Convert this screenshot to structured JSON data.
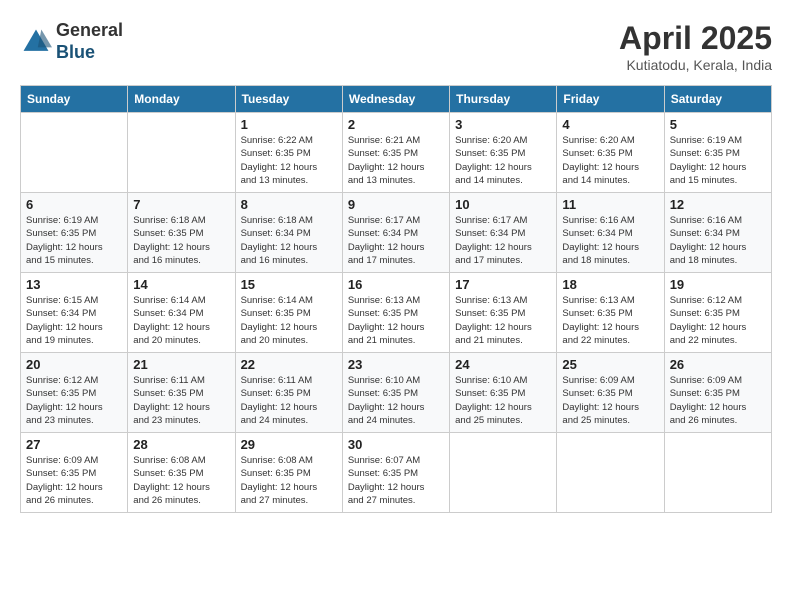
{
  "header": {
    "logo_general": "General",
    "logo_blue": "Blue",
    "month_title": "April 2025",
    "location": "Kutiatodu, Kerala, India"
  },
  "weekdays": [
    "Sunday",
    "Monday",
    "Tuesday",
    "Wednesday",
    "Thursday",
    "Friday",
    "Saturday"
  ],
  "weeks": [
    [
      null,
      null,
      {
        "day": 1,
        "sunrise": "6:22 AM",
        "sunset": "6:35 PM",
        "daylight": "12 hours and 13 minutes."
      },
      {
        "day": 2,
        "sunrise": "6:21 AM",
        "sunset": "6:35 PM",
        "daylight": "12 hours and 13 minutes."
      },
      {
        "day": 3,
        "sunrise": "6:20 AM",
        "sunset": "6:35 PM",
        "daylight": "12 hours and 14 minutes."
      },
      {
        "day": 4,
        "sunrise": "6:20 AM",
        "sunset": "6:35 PM",
        "daylight": "12 hours and 14 minutes."
      },
      {
        "day": 5,
        "sunrise": "6:19 AM",
        "sunset": "6:35 PM",
        "daylight": "12 hours and 15 minutes."
      }
    ],
    [
      {
        "day": 6,
        "sunrise": "6:19 AM",
        "sunset": "6:35 PM",
        "daylight": "12 hours and 15 minutes."
      },
      {
        "day": 7,
        "sunrise": "6:18 AM",
        "sunset": "6:35 PM",
        "daylight": "12 hours and 16 minutes."
      },
      {
        "day": 8,
        "sunrise": "6:18 AM",
        "sunset": "6:34 PM",
        "daylight": "12 hours and 16 minutes."
      },
      {
        "day": 9,
        "sunrise": "6:17 AM",
        "sunset": "6:34 PM",
        "daylight": "12 hours and 17 minutes."
      },
      {
        "day": 10,
        "sunrise": "6:17 AM",
        "sunset": "6:34 PM",
        "daylight": "12 hours and 17 minutes."
      },
      {
        "day": 11,
        "sunrise": "6:16 AM",
        "sunset": "6:34 PM",
        "daylight": "12 hours and 18 minutes."
      },
      {
        "day": 12,
        "sunrise": "6:16 AM",
        "sunset": "6:34 PM",
        "daylight": "12 hours and 18 minutes."
      }
    ],
    [
      {
        "day": 13,
        "sunrise": "6:15 AM",
        "sunset": "6:34 PM",
        "daylight": "12 hours and 19 minutes."
      },
      {
        "day": 14,
        "sunrise": "6:14 AM",
        "sunset": "6:34 PM",
        "daylight": "12 hours and 20 minutes."
      },
      {
        "day": 15,
        "sunrise": "6:14 AM",
        "sunset": "6:35 PM",
        "daylight": "12 hours and 20 minutes."
      },
      {
        "day": 16,
        "sunrise": "6:13 AM",
        "sunset": "6:35 PM",
        "daylight": "12 hours and 21 minutes."
      },
      {
        "day": 17,
        "sunrise": "6:13 AM",
        "sunset": "6:35 PM",
        "daylight": "12 hours and 21 minutes."
      },
      {
        "day": 18,
        "sunrise": "6:13 AM",
        "sunset": "6:35 PM",
        "daylight": "12 hours and 22 minutes."
      },
      {
        "day": 19,
        "sunrise": "6:12 AM",
        "sunset": "6:35 PM",
        "daylight": "12 hours and 22 minutes."
      }
    ],
    [
      {
        "day": 20,
        "sunrise": "6:12 AM",
        "sunset": "6:35 PM",
        "daylight": "12 hours and 23 minutes."
      },
      {
        "day": 21,
        "sunrise": "6:11 AM",
        "sunset": "6:35 PM",
        "daylight": "12 hours and 23 minutes."
      },
      {
        "day": 22,
        "sunrise": "6:11 AM",
        "sunset": "6:35 PM",
        "daylight": "12 hours and 24 minutes."
      },
      {
        "day": 23,
        "sunrise": "6:10 AM",
        "sunset": "6:35 PM",
        "daylight": "12 hours and 24 minutes."
      },
      {
        "day": 24,
        "sunrise": "6:10 AM",
        "sunset": "6:35 PM",
        "daylight": "12 hours and 25 minutes."
      },
      {
        "day": 25,
        "sunrise": "6:09 AM",
        "sunset": "6:35 PM",
        "daylight": "12 hours and 25 minutes."
      },
      {
        "day": 26,
        "sunrise": "6:09 AM",
        "sunset": "6:35 PM",
        "daylight": "12 hours and 26 minutes."
      }
    ],
    [
      {
        "day": 27,
        "sunrise": "6:09 AM",
        "sunset": "6:35 PM",
        "daylight": "12 hours and 26 minutes."
      },
      {
        "day": 28,
        "sunrise": "6:08 AM",
        "sunset": "6:35 PM",
        "daylight": "12 hours and 26 minutes."
      },
      {
        "day": 29,
        "sunrise": "6:08 AM",
        "sunset": "6:35 PM",
        "daylight": "12 hours and 27 minutes."
      },
      {
        "day": 30,
        "sunrise": "6:07 AM",
        "sunset": "6:35 PM",
        "daylight": "12 hours and 27 minutes."
      },
      null,
      null,
      null
    ]
  ],
  "labels": {
    "sunrise_label": "Sunrise:",
    "sunset_label": "Sunset:",
    "daylight_label": "Daylight:"
  }
}
